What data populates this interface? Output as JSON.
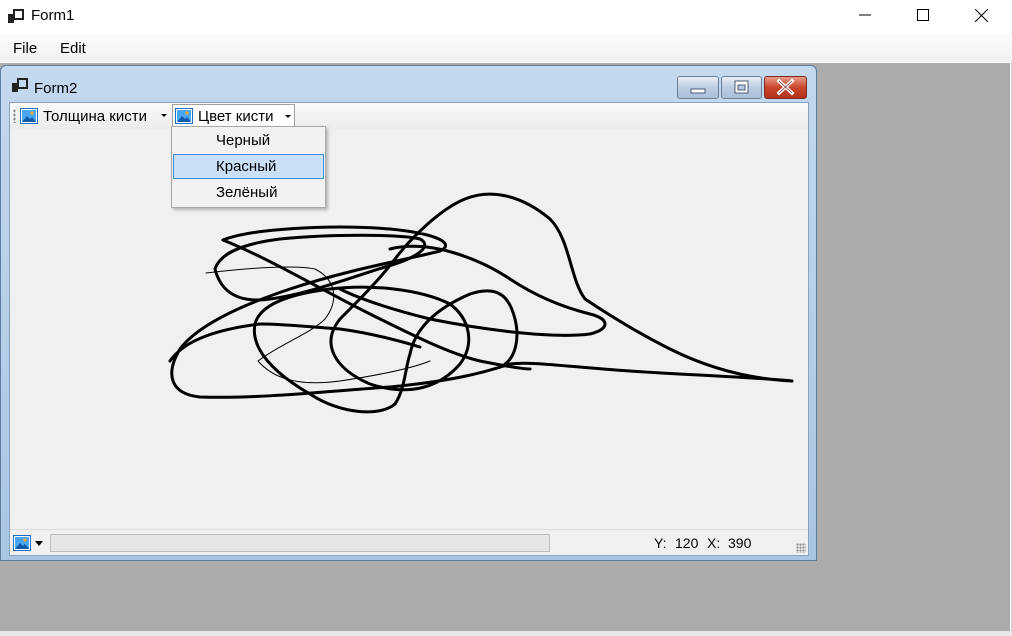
{
  "form1": {
    "title": "Form1",
    "icon": "windows-app-icon",
    "menu": [
      "File",
      "Edit"
    ]
  },
  "form2": {
    "title": "Form2",
    "icon": "windows-app-icon",
    "toolstrip": {
      "brush_width_label": "Толщина кисти",
      "brush_color_label": "Цвет кисти",
      "color_options": [
        "Черный",
        "Красный",
        "Зелёный"
      ],
      "selected_color": "Красный"
    },
    "status": {
      "progress": 0,
      "y_label": "Y:",
      "y_value": "120",
      "x_label": "X:",
      "x_value": "390"
    }
  },
  "colors": {
    "mdi_background": "#ababab",
    "selection_fill": "#c9e0f7",
    "selection_border": "#3d8ee0",
    "close_button": "#c9462c",
    "stroke": "#000000"
  }
}
